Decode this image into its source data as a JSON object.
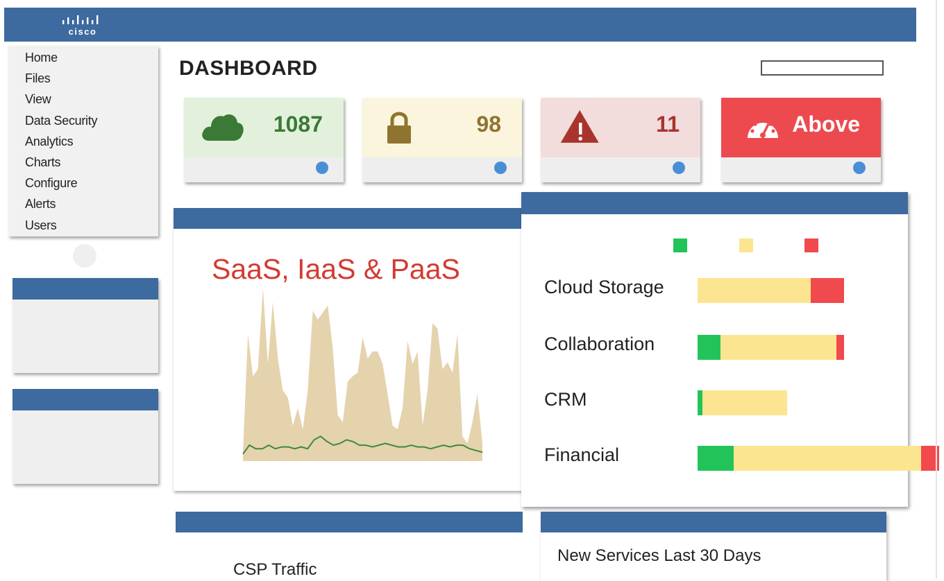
{
  "brand": {
    "logo_text": "cisco"
  },
  "menu": {
    "items": [
      "Home",
      "Files",
      "View",
      "Data Security",
      "Analytics",
      "Charts",
      "Configure",
      "Alerts",
      "Users"
    ]
  },
  "page_title": "DASHBOARD",
  "search": {
    "value": ""
  },
  "kpis": [
    {
      "icon": "cloud-icon",
      "value": "1087",
      "color": "#3a7a36",
      "bg": "#e3f1dc"
    },
    {
      "icon": "lock-icon",
      "value": "98",
      "color": "#8f7430",
      "bg": "#fbf5de"
    },
    {
      "icon": "warning-icon",
      "value": "11",
      "color": "#a8342d",
      "bg": "#f2dcdc"
    },
    {
      "icon": "speedometer-icon",
      "value": "Above",
      "color": "#ffffff",
      "bg": "#ec4a4f"
    }
  ],
  "area_chart_title": "SaaS, IaaS & PaaS",
  "chart_data": [
    {
      "type": "area",
      "title": "SaaS, IaaS & PaaS",
      "x": [
        0,
        1,
        2,
        3,
        4,
        5,
        6,
        7,
        8,
        9,
        10,
        11,
        12,
        13,
        14,
        15,
        16,
        17,
        18,
        19,
        20,
        21,
        22,
        23,
        24,
        25,
        26,
        27,
        28,
        29,
        30,
        31,
        32,
        33,
        34,
        35,
        36,
        37,
        38,
        39,
        40,
        41,
        42,
        43,
        44,
        45,
        46,
        47,
        48
      ],
      "series": [
        {
          "color": "#e5d3ad",
          "values": [
            5,
            72,
            48,
            52,
            98,
            55,
            90,
            58,
            40,
            36,
            20,
            30,
            18,
            40,
            85,
            80,
            84,
            88,
            64,
            26,
            22,
            45,
            48,
            50,
            70,
            58,
            62,
            62,
            55,
            38,
            20,
            18,
            30,
            68,
            55,
            62,
            20,
            40,
            78,
            75,
            52,
            56,
            50,
            72,
            14,
            10,
            22,
            38,
            10
          ]
        },
        {
          "color": "#3c8a3c",
          "values": [
            4,
            9,
            7,
            7,
            9,
            7,
            8,
            8,
            7,
            8,
            7,
            12,
            14,
            11,
            9,
            10,
            12,
            11,
            9,
            9,
            8,
            9,
            10,
            9,
            8,
            8,
            9,
            8,
            8,
            7,
            8,
            9,
            8,
            9,
            9,
            7,
            6,
            5
          ]
        }
      ]
    },
    {
      "type": "bar",
      "stacked": true,
      "orientation": "horizontal",
      "categories": [
        "Cloud Storage",
        "Collaboration",
        "CRM",
        "Financial"
      ],
      "series": [
        {
          "color": "#22c45a",
          "values": [
            0,
            9,
            2,
            14
          ]
        },
        {
          "color": "#fce591",
          "values": [
            44,
            45,
            33,
            73
          ]
        },
        {
          "color": "#f04a4e",
          "values": [
            13,
            3,
            0,
            7
          ]
        }
      ]
    }
  ],
  "panels": {
    "bottom_left_text": "CSP Traffic",
    "bottom_right_text": "New Services Last 30 Days"
  },
  "colors": {
    "header": "#3d6a9f",
    "indicator": "#4a8fd6"
  }
}
